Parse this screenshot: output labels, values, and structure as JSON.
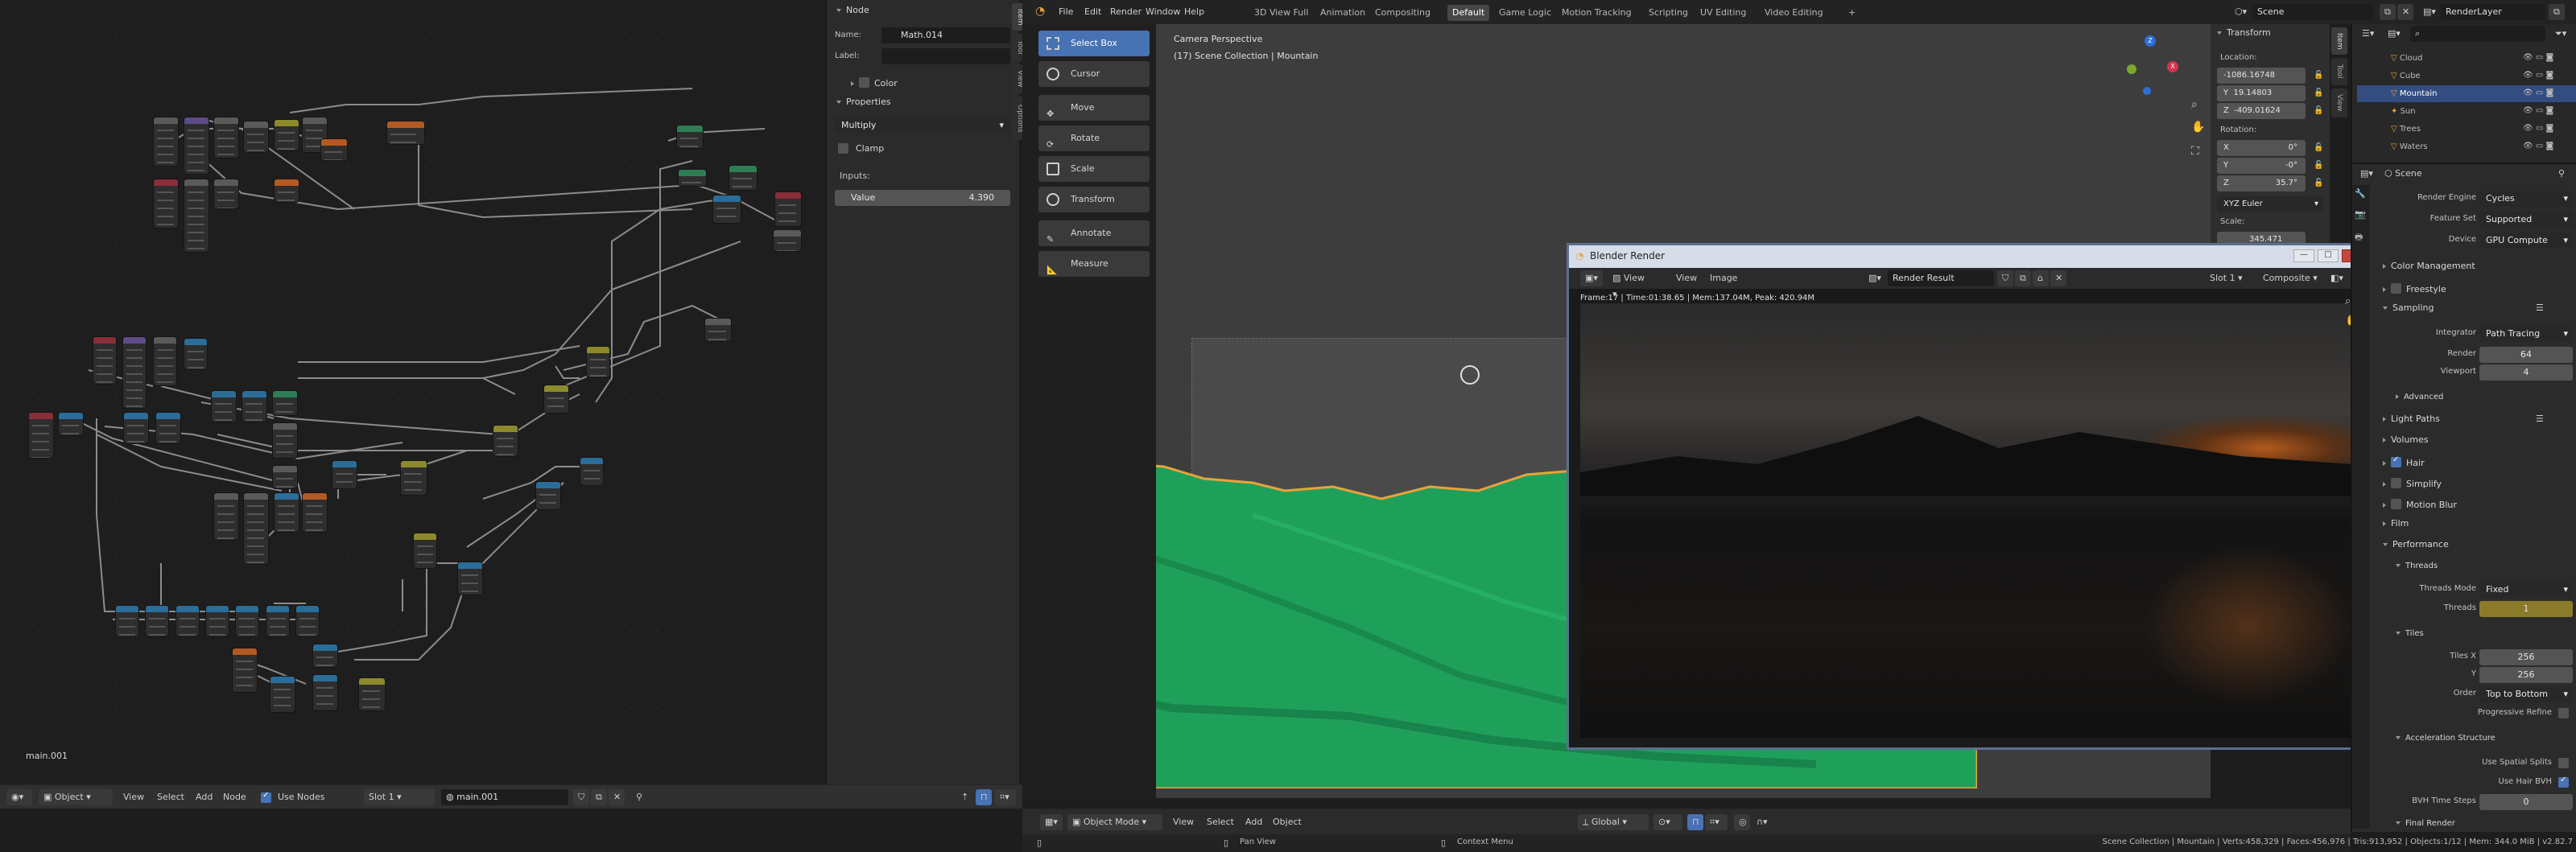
{
  "node_editor": {
    "tree_name": "main.001",
    "header": {
      "mode": "Object",
      "menus": [
        "View",
        "Select",
        "Add",
        "Node"
      ],
      "use_nodes_label": "Use Nodes",
      "slot": "Slot 1",
      "material": "main.001"
    }
  },
  "node_sidebar": {
    "tabs": [
      "Item",
      "Tool",
      "View",
      "Options"
    ],
    "node_section": "Node",
    "name_label": "Name:",
    "name_value": "Math.014",
    "label_label": "Label:",
    "label_value": "",
    "color_label": "Color",
    "properties_section": "Properties",
    "operation": "Multiply",
    "clamp_label": "Clamp",
    "inputs_label": "Inputs:",
    "value_label": "Value",
    "value_value": "4.390"
  },
  "topbar": {
    "menus": [
      "File",
      "Edit",
      "Render",
      "Window",
      "Help"
    ],
    "workspaces": [
      "3D View Full",
      "Animation",
      "Compositing",
      "Default",
      "Game Logic",
      "Motion Tracking",
      "Scripting",
      "UV Editing",
      "Video Editing"
    ],
    "active_workspace": "Default",
    "scene": "Scene",
    "render_layer": "RenderLayer"
  },
  "toolbar": {
    "tools": [
      "Select Box",
      "Cursor",
      "Move",
      "Rotate",
      "Scale",
      "Transform",
      "Annotate",
      "Measure"
    ],
    "active": "Select Box"
  },
  "viewport": {
    "camera_text": "Camera Perspective",
    "collection_text": "(17) Scene Collection | Mountain",
    "tabs": [
      "Item",
      "Tool",
      "View"
    ],
    "header": {
      "mode": "Object Mode",
      "menus": [
        "View",
        "Select",
        "Add",
        "Object"
      ],
      "transform": "Global"
    }
  },
  "transform_panel": {
    "title": "Transform",
    "location_label": "Location:",
    "location": [
      "-1086.16748",
      "19.14803",
      "-409.01624"
    ],
    "loc_axes": [
      "X",
      "Y",
      "Z"
    ],
    "rotation_label": "Rotation:",
    "rotation": [
      "0°",
      "-0°",
      "35.7°"
    ],
    "rotation_mode": "XYZ Euler",
    "scale_label": "Scale:",
    "scale_x": "345.471"
  },
  "render_window": {
    "title": "Blender Render",
    "menus": [
      "View",
      "View",
      "Image"
    ],
    "image_name": "Render Result",
    "slot": "Slot 1",
    "layer": "Composite",
    "stats": "Frame:17 | Time:01:38.65 | Mem:137.04M, Peak: 420.94M"
  },
  "outliner": {
    "items": [
      {
        "name": "Cloud",
        "selected": false
      },
      {
        "name": "Cube",
        "selected": false
      },
      {
        "name": "Mountain",
        "selected": true
      },
      {
        "name": "Sun",
        "selected": false
      },
      {
        "name": "Trees",
        "selected": false
      },
      {
        "name": "Waters",
        "selected": false
      }
    ]
  },
  "properties": {
    "scene_name": "Scene",
    "render_engine_label": "Render Engine",
    "render_engine": "Cycles",
    "feature_set_label": "Feature Set",
    "feature_set": "Supported",
    "device_label": "Device",
    "device": "GPU Compute",
    "color_management": "Color Management",
    "freestyle": "Freestyle",
    "sampling": "Sampling",
    "integrator_label": "Integrator",
    "integrator": "Path Tracing",
    "render_label": "Render",
    "render_samples": "64",
    "viewport_label": "Viewport",
    "viewport_samples": "4",
    "advanced": "Advanced",
    "light_paths": "Light Paths",
    "volumes": "Volumes",
    "hair": "Hair",
    "simplify": "Simplify",
    "motion_blur": "Motion Blur",
    "film": "Film",
    "performance": "Performance",
    "threads": "Threads",
    "threads_mode_label": "Threads Mode",
    "threads_mode": "Fixed",
    "threads_label": "Threads",
    "threads_value": "1",
    "tiles": "Tiles",
    "tiles_x_label": "Tiles X",
    "tiles_x": "256",
    "tiles_y_label": "Y",
    "tiles_y": "256",
    "order_label": "Order",
    "order": "Top to Bottom",
    "progressive_refine": "Progressive Refine",
    "accel_structure": "Acceleration Structure",
    "use_spatial_splits": "Use Spatial Splits",
    "use_hair_bvh": "Use Hair BVH",
    "bvh_time_steps_label": "BVH Time Steps",
    "bvh_time_steps": "0",
    "final_render": "Final Render"
  },
  "statusbar": {
    "pan_view": "Pan View",
    "context_menu": "Context Menu",
    "stats": "Scene Collection | Mountain | Verts:458,329 | Faces:456,976 | Tris:913,952 | Objects:1/12 | Mem: 344.0 MiB | v2.82.7"
  },
  "colors": {
    "accent": "#4772b3",
    "mountain": "#1faa5a",
    "selection_outline": "#e8a33a"
  }
}
